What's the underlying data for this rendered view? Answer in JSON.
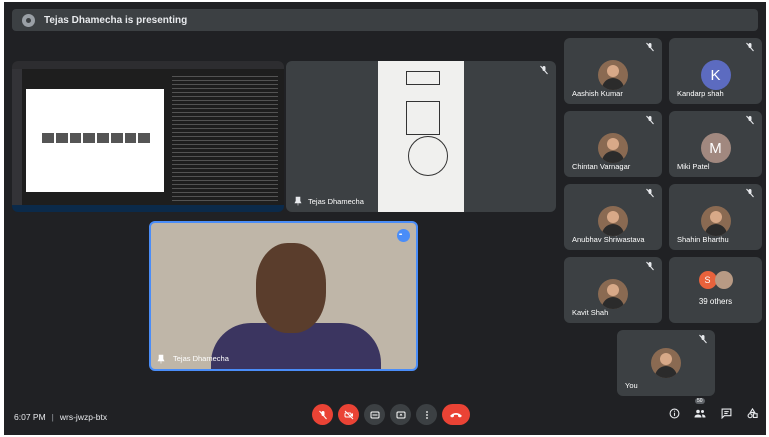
{
  "banner": {
    "text": "Tejas Dhamecha is presenting"
  },
  "presentation": {
    "presenter_name": "Tejas Dhamecha"
  },
  "speaker": {
    "name": "Tejas Dhamecha"
  },
  "participants": [
    {
      "name": "Aashish Kumar",
      "initial": ""
    },
    {
      "name": "Kandarp shah",
      "initial": "K"
    },
    {
      "name": "Chintan Varnagar",
      "initial": ""
    },
    {
      "name": "Miki Patel",
      "initial": "M"
    },
    {
      "name": "Anubhav Shriwastava",
      "initial": ""
    },
    {
      "name": "Shahin Bharthu",
      "initial": ""
    },
    {
      "name": "Kavit Shah",
      "initial": ""
    }
  ],
  "others": {
    "initial": "S",
    "count_label": "39 others"
  },
  "self_tile": {
    "name": "You"
  },
  "meeting": {
    "time": "6:07 PM",
    "separator": "|",
    "code": "wrs-jwzp-btx"
  },
  "people_badge": "50",
  "icons": {
    "mic_off": "mic-off-icon",
    "cam_off": "video-off-icon",
    "captions": "captions-icon",
    "present": "present-icon",
    "more": "more-options-icon",
    "end": "end-call-icon",
    "info": "info-icon",
    "people": "people-icon",
    "chat": "chat-icon",
    "activities": "activities-icon"
  },
  "colors": {
    "background": "#202124",
    "tile": "#3c4043",
    "danger": "#ea4335",
    "accent": "#4a8df8"
  }
}
